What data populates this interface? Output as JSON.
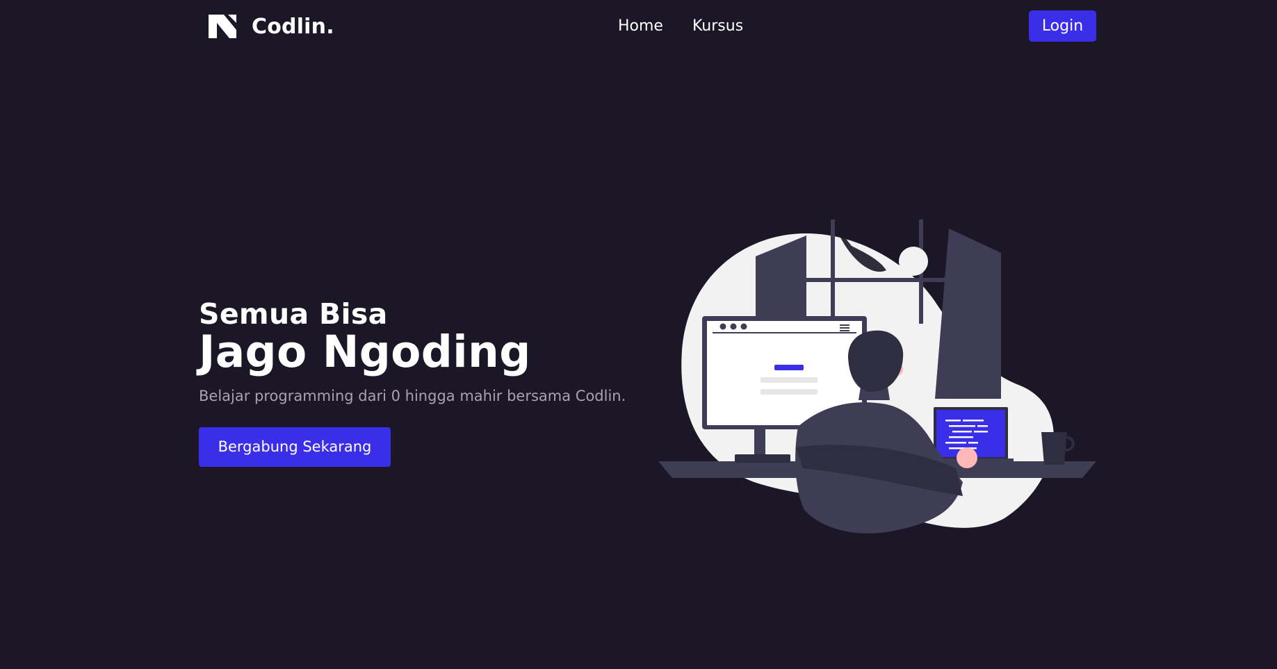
{
  "navbar": {
    "brand_name": "Codlin.",
    "logo_icon": "codlin-logo-icon",
    "links": [
      {
        "label": "Home"
      },
      {
        "label": "Kursus"
      }
    ],
    "login_label": "Login"
  },
  "hero": {
    "subtitle": "Semua Bisa",
    "title": "Jago Ngoding",
    "description": "Belajar programming dari 0 hingga mahir bersama Codlin.",
    "cta_label": "Bergabung Sekarang",
    "illustration": "programmer-at-desk-illustration"
  },
  "colors": {
    "background": "#1b1727",
    "accent": "#3a2ee8",
    "text": "#ffffff",
    "muted_text": "#a7a3b3",
    "illustration_light": "#f2f2f2",
    "illustration_dark": "#3f3d56"
  }
}
